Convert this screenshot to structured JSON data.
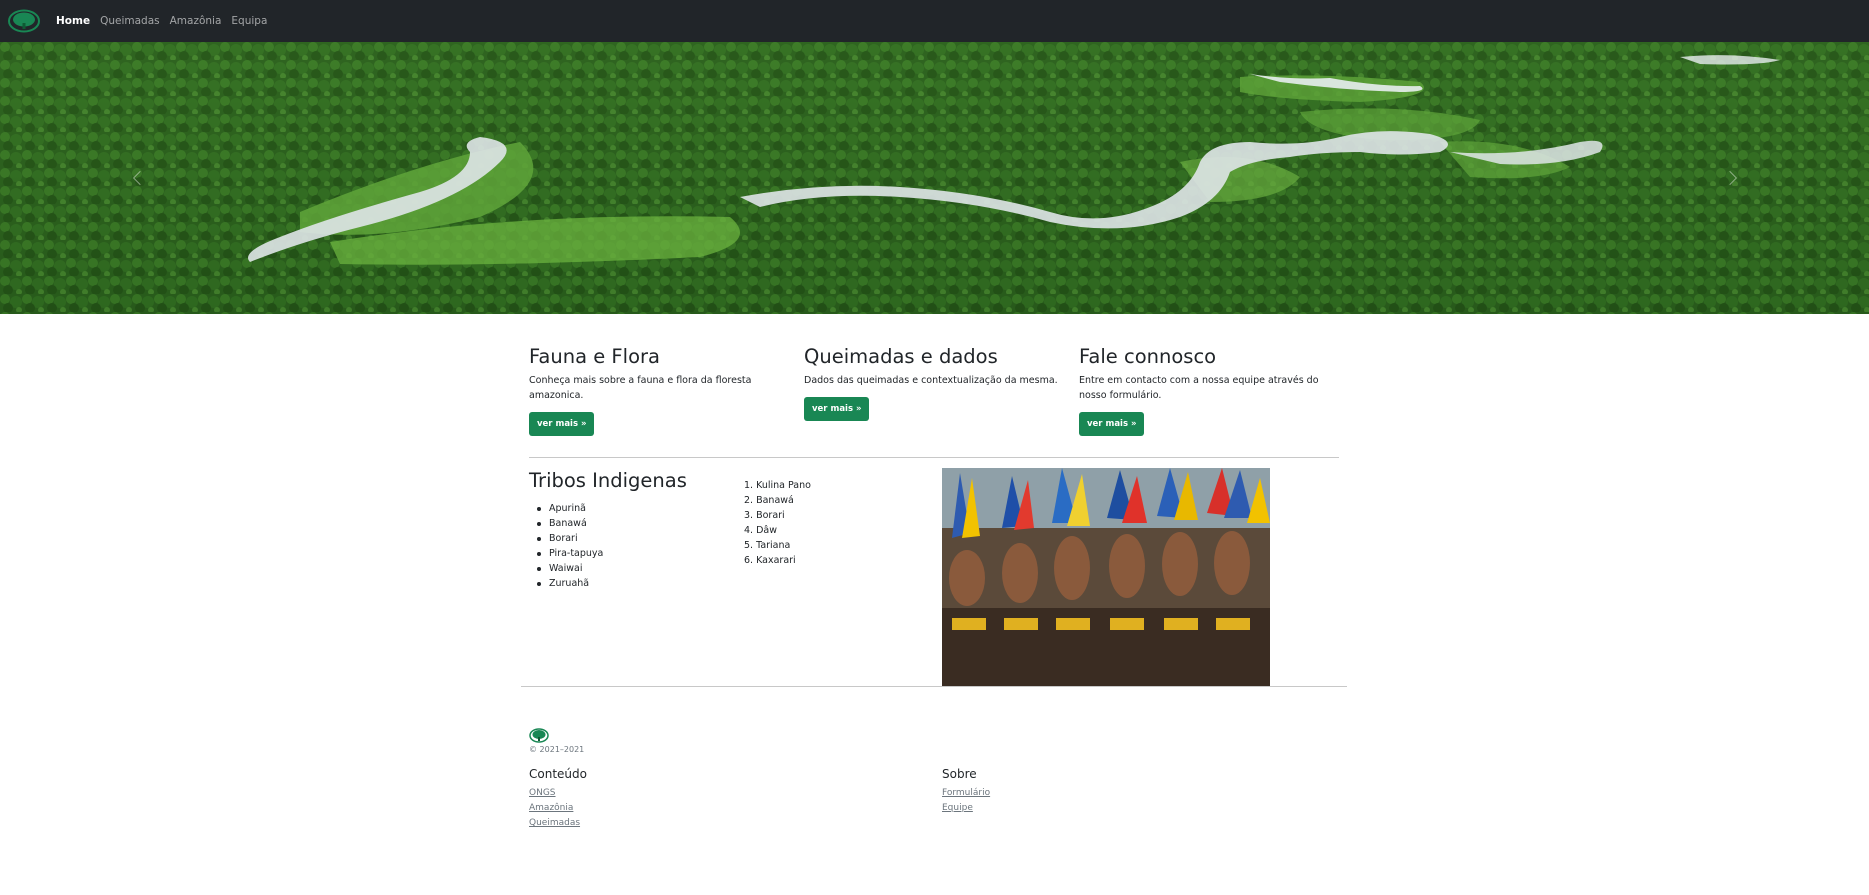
{
  "navbar": {
    "logo": "tree-logo-icon",
    "links": [
      {
        "label": "Home",
        "active": true
      },
      {
        "label": "Queimadas",
        "active": false
      },
      {
        "label": "Amazônia",
        "active": false
      },
      {
        "label": "Equipa",
        "active": false
      }
    ]
  },
  "hero": {
    "image": "amazon-river-aerial",
    "controls": {
      "prev": "chevron-left-icon",
      "next": "chevron-right-icon"
    }
  },
  "features": [
    {
      "title": "Fauna e Flora",
      "text": "Conheça mais sobre a fauna e flora da floresta amazonica.",
      "button": "ver mais »"
    },
    {
      "title": "Queimadas e dados",
      "text": "Dados das queimadas e contextualização da mesma.",
      "button": "ver mais »"
    },
    {
      "title": "Fale connosco",
      "text": "Entre em contacto com a nossa equipe através do nosso formulário.",
      "button": "ver mais »"
    }
  ],
  "tribes": {
    "title": "Tribos Indigenas",
    "bullets": [
      "Apurinã",
      "Banawá",
      "Borari",
      "Pira-tapuya",
      "Waiwai",
      "Zuruahã"
    ],
    "numbered": [
      "1. Kulina Pano",
      "2. Banawá",
      "3. Borari",
      "4. Dâw",
      "5. Tariana",
      "6. Kaxarari"
    ],
    "photo": "indigenous-dancers-photo"
  },
  "footer": {
    "copyright": "© 2021–2021",
    "columns": [
      {
        "title": "Conteúdo",
        "links": [
          "ONGS",
          "Amazônia",
          "Queimadas"
        ]
      },
      {
        "title": "Sobre",
        "links": [
          "Formulário",
          "Equipe"
        ]
      }
    ]
  },
  "colors": {
    "navbar": "#212529",
    "button": "#198754",
    "forest": "#2f6b22",
    "river": "#dfe6e8"
  }
}
